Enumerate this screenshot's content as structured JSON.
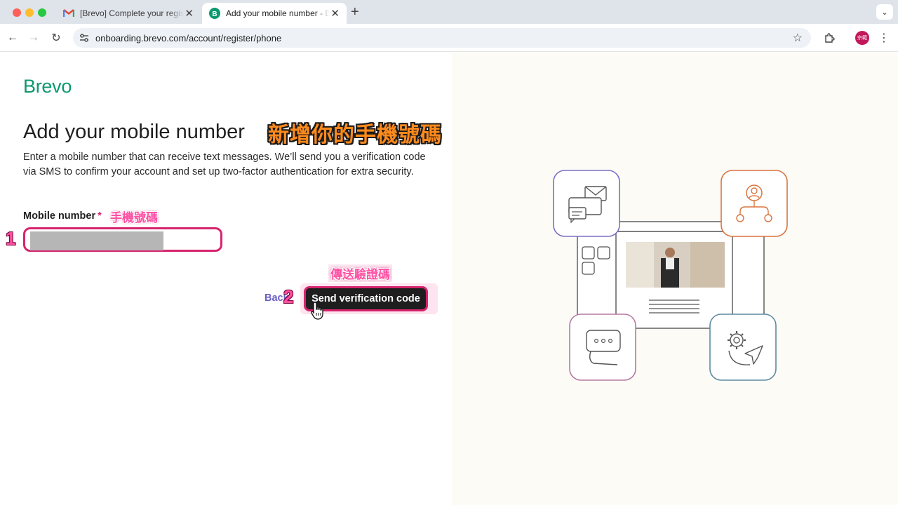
{
  "browser": {
    "tabs": [
      {
        "title": "[Brevo] Complete your registration",
        "favicon": "gmail-icon",
        "active": false
      },
      {
        "title": "Add your mobile number - Brevo",
        "favicon": "brevo-icon",
        "active": true
      }
    ],
    "url": "onboarding.brevo.com/account/register/phone",
    "profile_initials": "宗範",
    "colors": {
      "tab_bar": "#dfe3ea",
      "omnibox": "#eef1f6",
      "profile": "#c2185b"
    }
  },
  "page": {
    "logo": "Brevo",
    "heading": "Add your mobile number",
    "description": "Enter a mobile number that can receive text messages. We’ll send you a verification code via SMS to confirm your account and set up two-factor authentication for extra security.",
    "field_label": "Mobile number",
    "required_mark": "*",
    "phone_value": "",
    "back_label": "Back",
    "send_label": "Send verification code",
    "colors": {
      "brand": "#0b996e",
      "button": "#1e1e1e",
      "back_link": "#6c5fc7",
      "illustration_bg": "#fcfbf6"
    }
  },
  "annotations": {
    "title_note": "新增你的手機號碼",
    "field_note": "手機號碼",
    "step1": "1",
    "step2": "2",
    "send_note": "傳送驗證碼",
    "colors": {
      "highlight": "#d6246e",
      "title_note": "#ff8a1c",
      "notes": "#ff4fa3"
    }
  },
  "illustration": {
    "icons": [
      "email-chat-icon",
      "user-network-icon",
      "message-bubble-icon",
      "gear-send-icon",
      "layout-grid-icon",
      "video-thumbnail"
    ]
  }
}
